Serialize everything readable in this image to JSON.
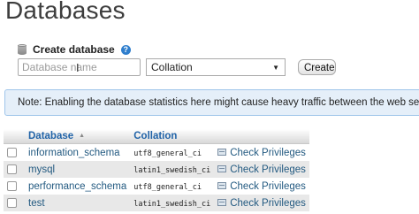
{
  "page": {
    "title": "Databases"
  },
  "create": {
    "heading": "Create database",
    "help_icon": "help-icon",
    "name_placeholder": "Database name",
    "collation_value": "Collation",
    "button_label": "Create"
  },
  "note": {
    "text": "Note: Enabling the database statistics here might cause heavy traffic between the web server and"
  },
  "table": {
    "headers": {
      "database": "Database",
      "collation": "Collation"
    },
    "rows": [
      {
        "name": "information_schema",
        "collation": "utf8_general_ci",
        "action": "Check Privileges"
      },
      {
        "name": "mysql",
        "collation": "latin1_swedish_ci",
        "action": "Check Privileges"
      },
      {
        "name": "performance_schema",
        "collation": "utf8_general_ci",
        "action": "Check Privileges"
      },
      {
        "name": "test",
        "collation": "latin1_swedish_ci",
        "action": "Check Privileges"
      }
    ]
  },
  "colors": {
    "link": "#235a81",
    "note_bg": "#e5eff9",
    "note_border": "#9fc5ea",
    "warning": "#f0b400"
  }
}
